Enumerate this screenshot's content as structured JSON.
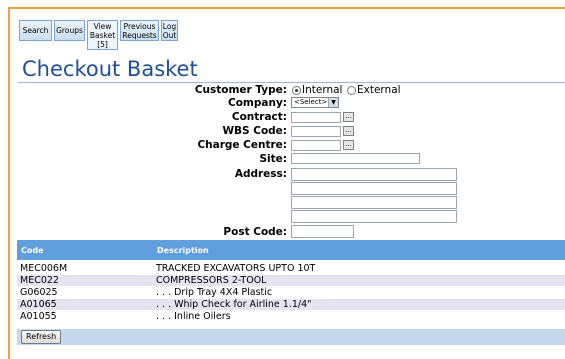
{
  "nav": {
    "tabs": [
      {
        "label": "Search"
      },
      {
        "label": "Groups"
      },
      {
        "label": "View Basket [5]"
      },
      {
        "label": "Previous Requests"
      },
      {
        "label": "Log Out"
      }
    ]
  },
  "page": {
    "title": "Checkout Basket"
  },
  "form": {
    "customer_type_label": "Customer Type:",
    "customer_type_options": [
      "Internal",
      "External"
    ],
    "customer_type_selected": "Internal",
    "company_label": "Company:",
    "company_value": "<Select>",
    "contract_label": "Contract:",
    "wbs_label": "WBS Code:",
    "charge_label": "Charge Centre:",
    "site_label": "Site:",
    "address_label": "Address:",
    "postcode_label": "Post Code:",
    "lookup_button": "..."
  },
  "table": {
    "headers": [
      "Code",
      "Description"
    ],
    "rows": [
      {
        "code": "MEC006M",
        "desc": "TRACKED EXCAVATORS UPTO 10T"
      },
      {
        "code": "MEC022",
        "desc": "COMPRESSORS 2-TOOL"
      },
      {
        "code": "G06025",
        "desc": ". . . Drip Tray 4X4 Plastic"
      },
      {
        "code": "A01065",
        "desc": ". . . Whip Check for Airline 1.1/4\""
      },
      {
        "code": "A01055",
        "desc": ". . . Inline Oilers"
      }
    ]
  },
  "refresh_label": "Refresh",
  "colors": {
    "accent_frame": "#f0a040",
    "title": "#1f4f9b",
    "header_bg": "#5f9fde",
    "alt_row": "#e7e3f3"
  }
}
